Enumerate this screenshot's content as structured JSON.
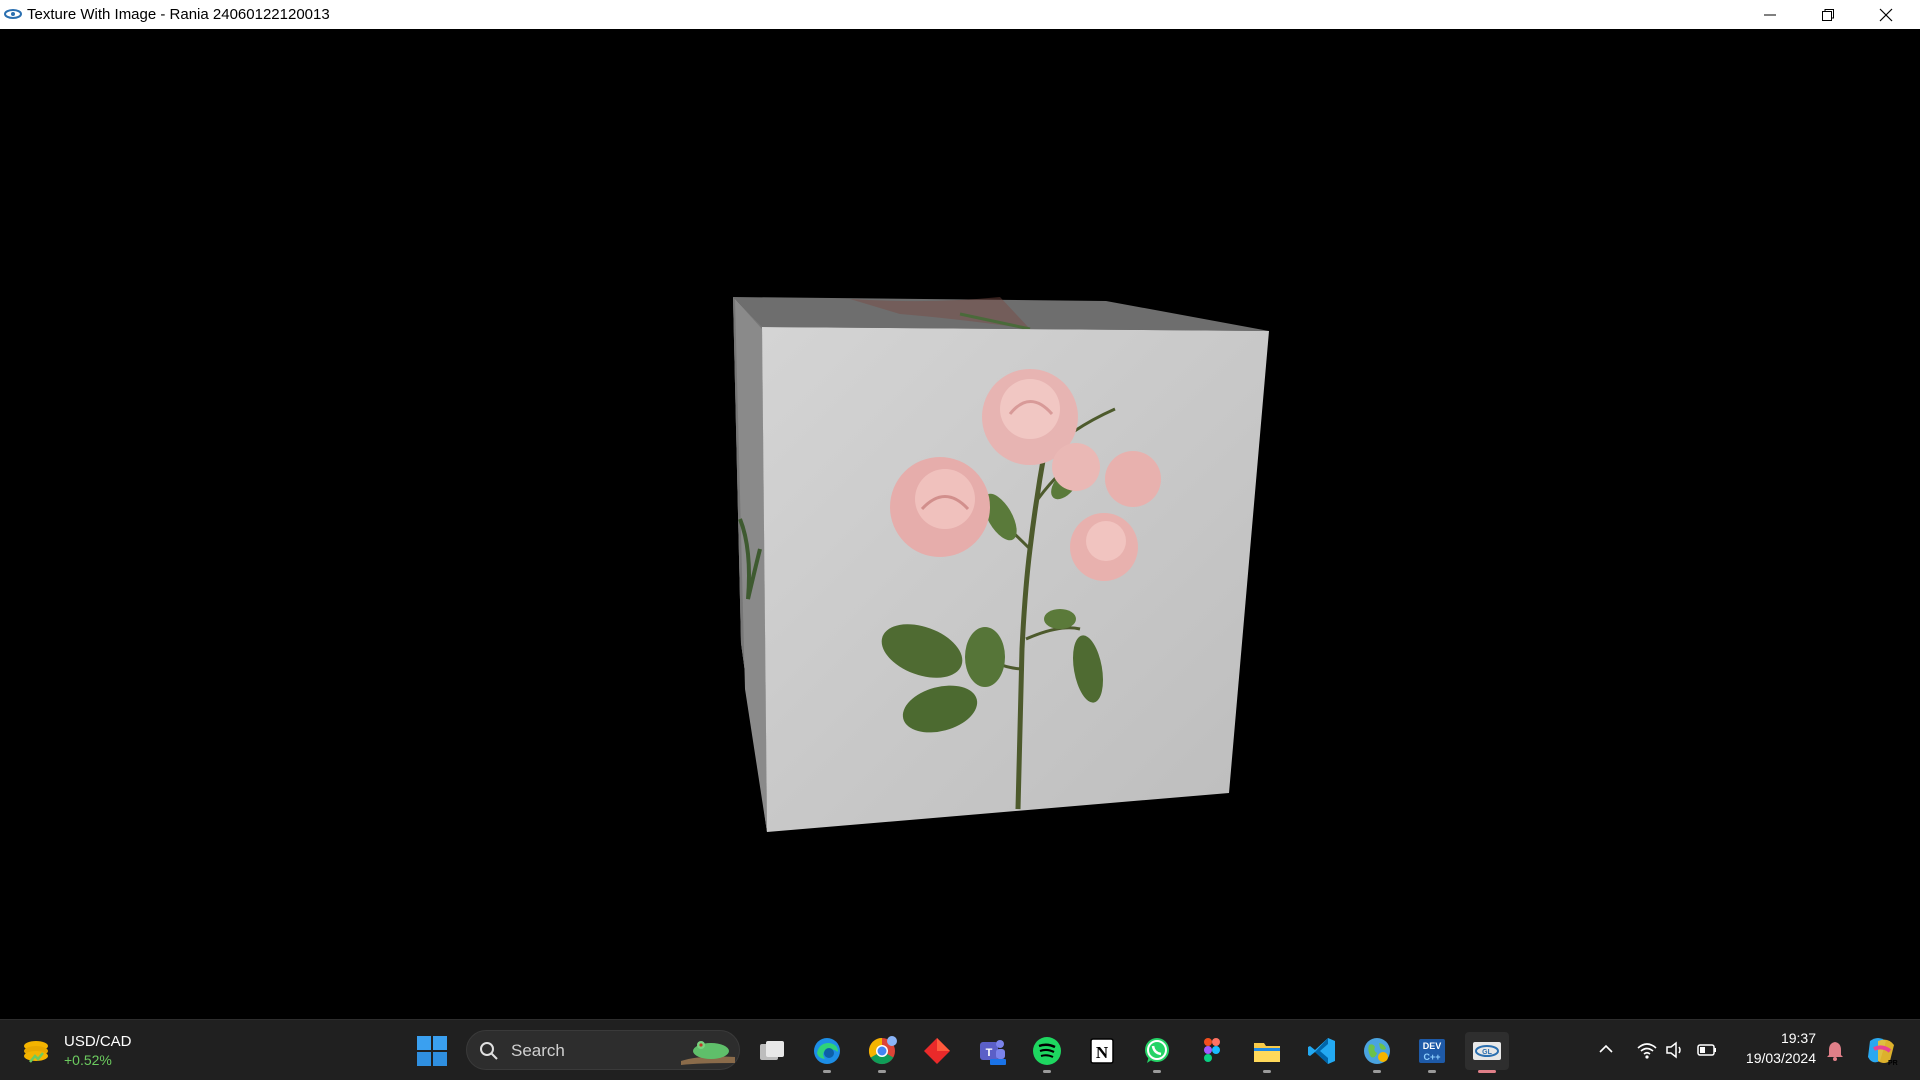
{
  "window": {
    "title": "Texture With Image - Rania 24060122120013",
    "app_icon": "opengl-app-icon",
    "controls": [
      "minimize-icon",
      "restore-icon",
      "close-icon"
    ]
  },
  "scene": {
    "background": "#000000",
    "object": "textured-cube",
    "texture": "pink-rose-bouquet",
    "face_color": "#cfcfcf"
  },
  "taskbar": {
    "widget": {
      "title": "USD/CAD",
      "change": "+0.52%",
      "change_color": "#6ccb5f"
    },
    "search": {
      "placeholder": "Search"
    },
    "pinned": [
      {
        "name": "task-view-icon"
      },
      {
        "name": "edge-icon",
        "running": true
      },
      {
        "name": "chrome-icon",
        "running": true
      },
      {
        "name": "anydo-icon"
      },
      {
        "name": "teams-icon"
      },
      {
        "name": "spotify-icon",
        "running": true
      },
      {
        "name": "notion-icon"
      },
      {
        "name": "whatsapp-icon",
        "running": true
      },
      {
        "name": "figma-icon"
      },
      {
        "name": "file-explorer-icon",
        "running": true
      },
      {
        "name": "vscode-icon"
      },
      {
        "name": "internet-globe-icon",
        "running": true
      },
      {
        "name": "devcpp-icon",
        "running": true
      },
      {
        "name": "opengl-app-icon",
        "running": true,
        "active": true
      }
    ],
    "tray": {
      "icons": [
        "chevron-up-icon",
        "wifi-icon",
        "volume-icon",
        "battery-icon"
      ],
      "time": "19:37",
      "date": "19/03/2024"
    },
    "accent": "#e07f88"
  }
}
